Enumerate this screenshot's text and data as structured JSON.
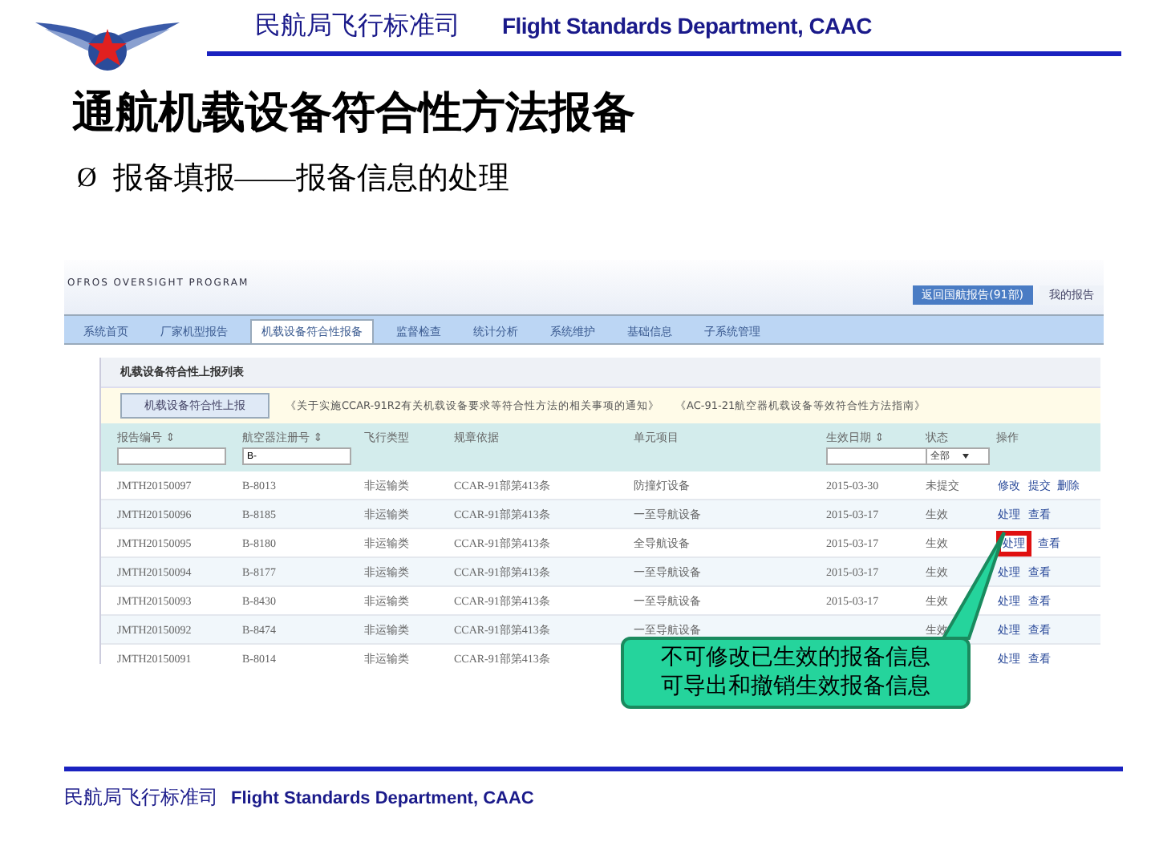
{
  "header": {
    "agency": "民航局飞行标准司",
    "department": "Flight Standards Department, CAAC"
  },
  "title": "通航机载设备符合性方法报备",
  "bullet": {
    "marker": "Ø",
    "text": "报备填报——报备信息的处理"
  },
  "screenshot": {
    "subtitle": "OFROS OVERSIGHT PROGRAM",
    "top_buttons": [
      {
        "label": "返回国航报告(91部)",
        "selected": true
      },
      {
        "label": "我的报告",
        "selected": false
      }
    ],
    "nav_tabs": [
      {
        "label": "系统首页",
        "selected": false
      },
      {
        "label": "厂家机型报告",
        "selected": false
      },
      {
        "label": "机载设备符合性报备",
        "selected": true
      },
      {
        "label": "监督检查",
        "selected": false
      },
      {
        "label": "统计分析",
        "selected": false
      },
      {
        "label": "系统维护",
        "selected": false
      },
      {
        "label": "基础信息",
        "selected": false
      },
      {
        "label": "子系统管理",
        "selected": false
      }
    ],
    "panel_title": "机载设备符合性上报列表",
    "add_button": "机载设备符合性上报",
    "notices": [
      "《关于实施CCAR-91R2有关机载设备要求等符合性方法的相关事项的通知》",
      "《AC-91-21航空器机载设备等效符合性方法指南》"
    ],
    "columns": [
      {
        "label": "报告编号 ⇕",
        "kind": "input"
      },
      {
        "label": "航空器注册号 ⇕",
        "kind": "input",
        "value": "B-"
      },
      {
        "label": "飞行类型",
        "kind": "plain"
      },
      {
        "label": "规章依据",
        "kind": "plain"
      },
      {
        "label": "单元项目",
        "kind": "plain"
      },
      {
        "label": "生效日期 ⇕",
        "kind": "input"
      },
      {
        "label": "状态",
        "kind": "select",
        "value": "全部"
      },
      {
        "label": "操作",
        "kind": "plain"
      }
    ],
    "rows": [
      {
        "cells": [
          "JMTH20150097",
          "B-8013",
          "非运输类",
          "CCAR-91部第413条",
          "防撞灯设备",
          "2015-03-30",
          "未提交"
        ],
        "actions": [
          "修改",
          "提交",
          "删除"
        ],
        "highlighted": false
      },
      {
        "cells": [
          "JMTH20150096",
          "B-8185",
          "非运输类",
          "CCAR-91部第413条",
          "一至导航设备",
          "2015-03-17",
          "生效"
        ],
        "actions": [
          "处理",
          "查看"
        ],
        "highlighted": false
      },
      {
        "cells": [
          "JMTH20150095",
          "B-8180",
          "非运输类",
          "CCAR-91部第413条",
          "全导航设备",
          "2015-03-17",
          "生效"
        ],
        "actions": [
          "处理",
          "查看"
        ],
        "highlighted": true
      },
      {
        "cells": [
          "JMTH20150094",
          "B-8177",
          "非运输类",
          "CCAR-91部第413条",
          "一至导航设备",
          "2015-03-17",
          "生效"
        ],
        "actions": [
          "处理",
          "查看"
        ],
        "highlighted": false
      },
      {
        "cells": [
          "JMTH20150093",
          "B-8430",
          "非运输类",
          "CCAR-91部第413条",
          "一至导航设备",
          "2015-03-17",
          "生效"
        ],
        "actions": [
          "处理",
          "查看"
        ],
        "highlighted": false
      },
      {
        "cells": [
          "JMTH20150092",
          "B-8474",
          "非运输类",
          "CCAR-91部第413条",
          "一至导航设备",
          "",
          "生效"
        ],
        "actions": [
          "处理",
          "查看"
        ],
        "highlighted": false
      },
      {
        "cells": [
          "JMTH20150091",
          "B-8014",
          "非运输类",
          "CCAR-91部第413条",
          "",
          "",
          ""
        ],
        "actions": [
          "处理",
          "查看"
        ],
        "highlighted": false
      }
    ]
  },
  "callout": [
    "不可修改已生效的报备信息",
    "可导出和撤销生效报备信息"
  ],
  "footer": {
    "agency": "民航局飞行标准司",
    "department": "Flight Standards Department, CAAC"
  }
}
